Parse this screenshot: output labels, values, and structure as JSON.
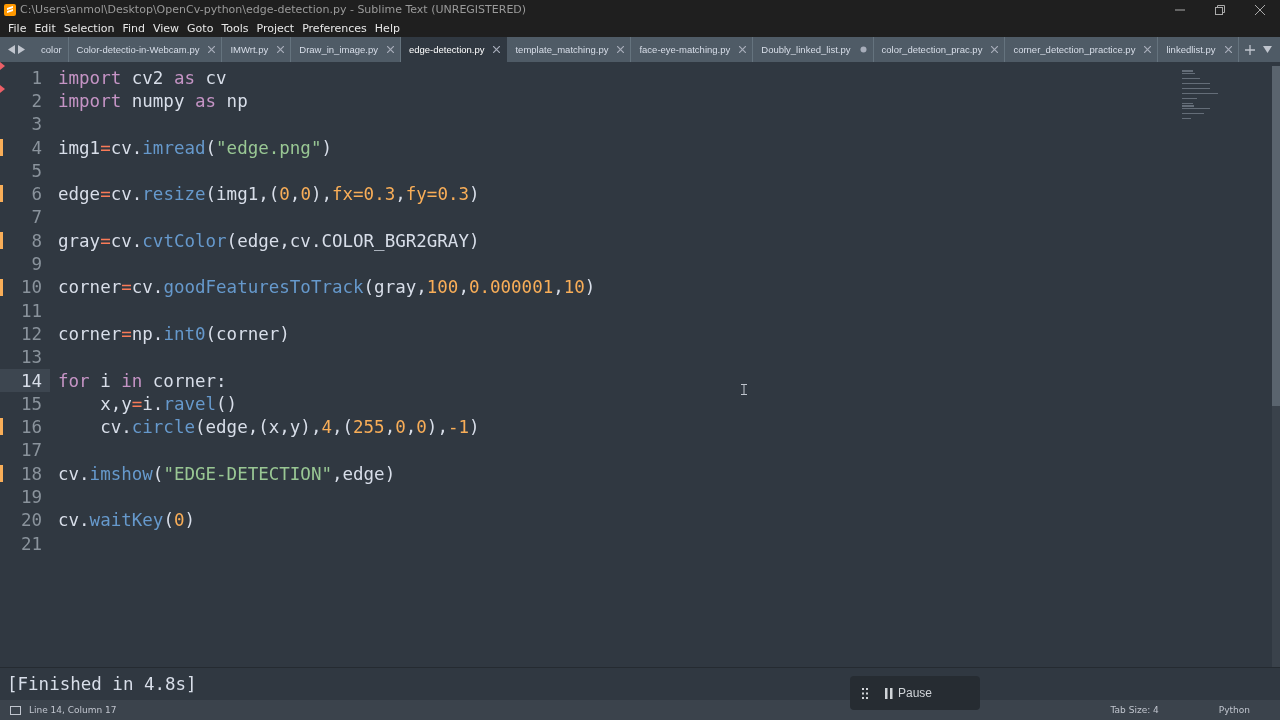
{
  "window": {
    "title": "C:\\Users\\anmol\\Desktop\\OpenCv-python\\edge-detection.py - Sublime Text (UNREGISTERED)"
  },
  "menu": [
    "File",
    "Edit",
    "Selection",
    "Find",
    "View",
    "Goto",
    "Tools",
    "Project",
    "Preferences",
    "Help"
  ],
  "tabs": [
    {
      "label": "color",
      "selected": false
    },
    {
      "label": "Color-detectio-in-Webcam.py",
      "selected": false,
      "unsaved": false
    },
    {
      "label": "IMWrt.py",
      "selected": false,
      "unsaved": false
    },
    {
      "label": "Draw_in_image.py",
      "selected": false,
      "unsaved": false
    },
    {
      "label": "edge-detection.py",
      "selected": true,
      "unsaved": false
    },
    {
      "label": "template_matching.py",
      "selected": false,
      "unsaved": false
    },
    {
      "label": "face-eye-matching.py",
      "selected": false,
      "unsaved": false
    },
    {
      "label": "Doubly_linked_list.py",
      "selected": false,
      "unsaved": true
    },
    {
      "label": "color_detection_prac.py",
      "selected": false,
      "unsaved": false
    },
    {
      "label": "corner_detection_practice.py",
      "selected": false,
      "unsaved": false
    },
    {
      "label": "linkedlist.py",
      "selected": false,
      "unsaved": false
    }
  ],
  "editor": {
    "lines": [
      {
        "number": "1",
        "deleted": true,
        "modified": false,
        "current": false,
        "tokens": [
          {
            "kind": "kw",
            "text": "import"
          },
          {
            "kind": "plain",
            "text": " cv2 "
          },
          {
            "kind": "kw",
            "text": "as"
          },
          {
            "kind": "plain",
            "text": " cv"
          }
        ]
      },
      {
        "number": "2",
        "deleted": true,
        "modified": false,
        "current": false,
        "tokens": [
          {
            "kind": "kw",
            "text": "import"
          },
          {
            "kind": "plain",
            "text": " numpy "
          },
          {
            "kind": "kw",
            "text": "as"
          },
          {
            "kind": "plain",
            "text": " np"
          }
        ]
      },
      {
        "number": "3",
        "deleted": false,
        "modified": false,
        "current": false
      },
      {
        "number": "4",
        "deleted": false,
        "modified": true,
        "current": false,
        "tokens": [
          {
            "kind": "plain",
            "text": "img1"
          },
          {
            "kind": "op",
            "text": "="
          },
          {
            "kind": "plain",
            "text": "cv."
          },
          {
            "kind": "fn",
            "text": "imread"
          },
          {
            "kind": "plain",
            "text": "("
          },
          {
            "kind": "str",
            "text": "\"edge.png\""
          },
          {
            "kind": "plain",
            "text": ")"
          }
        ]
      },
      {
        "number": "5",
        "deleted": false,
        "modified": false,
        "current": false
      },
      {
        "number": "6",
        "deleted": false,
        "modified": true,
        "current": false,
        "tokens": [
          {
            "kind": "plain",
            "text": "edge"
          },
          {
            "kind": "op",
            "text": "="
          },
          {
            "kind": "plain",
            "text": "cv."
          },
          {
            "kind": "fn",
            "text": "resize"
          },
          {
            "kind": "plain",
            "text": "(img1,("
          },
          {
            "kind": "num",
            "text": "0"
          },
          {
            "kind": "plain",
            "text": ","
          },
          {
            "kind": "num",
            "text": "0"
          },
          {
            "kind": "plain",
            "text": "),"
          },
          {
            "kind": "num",
            "text": "fx=0.3"
          },
          {
            "kind": "plain",
            "text": ","
          },
          {
            "kind": "num",
            "text": "fy=0.3"
          },
          {
            "kind": "plain",
            "text": ")"
          }
        ]
      },
      {
        "number": "7",
        "deleted": false,
        "modified": false,
        "current": false
      },
      {
        "number": "8",
        "deleted": false,
        "modified": true,
        "current": false,
        "tokens": [
          {
            "kind": "plain",
            "text": "gray"
          },
          {
            "kind": "op",
            "text": "="
          },
          {
            "kind": "plain",
            "text": "cv."
          },
          {
            "kind": "fn",
            "text": "cvtColor"
          },
          {
            "kind": "plain",
            "text": "(edge,cv.COLOR_BGR2GRAY)"
          }
        ]
      },
      {
        "number": "9",
        "deleted": false,
        "modified": false,
        "current": false
      },
      {
        "number": "10",
        "deleted": false,
        "modified": true,
        "current": false,
        "tokens": [
          {
            "kind": "plain",
            "text": "corner"
          },
          {
            "kind": "op",
            "text": "="
          },
          {
            "kind": "plain",
            "text": "cv."
          },
          {
            "kind": "fn",
            "text": "goodFeaturesToTrack"
          },
          {
            "kind": "plain",
            "text": "(gray,"
          },
          {
            "kind": "num",
            "text": "100"
          },
          {
            "kind": "plain",
            "text": ","
          },
          {
            "kind": "num",
            "text": "0.000001"
          },
          {
            "kind": "plain",
            "text": ","
          },
          {
            "kind": "num",
            "text": "10"
          },
          {
            "kind": "plain",
            "text": ")"
          }
        ]
      },
      {
        "number": "11",
        "deleted": false,
        "modified": false,
        "current": false
      },
      {
        "number": "12",
        "deleted": false,
        "modified": false,
        "current": false,
        "tokens": [
          {
            "kind": "plain",
            "text": "corner"
          },
          {
            "kind": "op",
            "text": "="
          },
          {
            "kind": "plain",
            "text": "np."
          },
          {
            "kind": "fn",
            "text": "int0"
          },
          {
            "kind": "plain",
            "text": "(corner)"
          }
        ]
      },
      {
        "number": "13",
        "deleted": false,
        "modified": false,
        "current": false
      },
      {
        "number": "14",
        "deleted": false,
        "modified": false,
        "current": true,
        "tokens": [
          {
            "kind": "kw",
            "text": "for"
          },
          {
            "kind": "plain",
            "text": " i "
          },
          {
            "kind": "kw",
            "text": "in"
          },
          {
            "kind": "plain",
            "text": " corner:"
          }
        ]
      },
      {
        "number": "15",
        "deleted": false,
        "modified": false,
        "current": false,
        "tokens": [
          {
            "kind": "plain",
            "text": "    x,y"
          },
          {
            "kind": "op",
            "text": "="
          },
          {
            "kind": "plain",
            "text": "i."
          },
          {
            "kind": "fn",
            "text": "ravel"
          },
          {
            "kind": "plain",
            "text": "()"
          }
        ]
      },
      {
        "number": "16",
        "deleted": false,
        "modified": true,
        "current": false,
        "tokens": [
          {
            "kind": "plain",
            "text": "    cv."
          },
          {
            "kind": "fn",
            "text": "circle"
          },
          {
            "kind": "plain",
            "text": "(edge,(x,y),"
          },
          {
            "kind": "num",
            "text": "4"
          },
          {
            "kind": "plain",
            "text": ",("
          },
          {
            "kind": "num",
            "text": "255"
          },
          {
            "kind": "plain",
            "text": ","
          },
          {
            "kind": "num",
            "text": "0"
          },
          {
            "kind": "plain",
            "text": ","
          },
          {
            "kind": "num",
            "text": "0"
          },
          {
            "kind": "plain",
            "text": "),"
          },
          {
            "kind": "num",
            "text": "-1"
          },
          {
            "kind": "plain",
            "text": ")"
          }
        ]
      },
      {
        "number": "17",
        "deleted": false,
        "modified": false,
        "current": false
      },
      {
        "number": "18",
        "deleted": false,
        "modified": true,
        "current": false,
        "tokens": [
          {
            "kind": "plain",
            "text": "cv."
          },
          {
            "kind": "fn",
            "text": "imshow"
          },
          {
            "kind": "plain",
            "text": "("
          },
          {
            "kind": "str",
            "text": "\"EDGE-DETECTION\""
          },
          {
            "kind": "plain",
            "text": ",edge)"
          }
        ]
      },
      {
        "number": "19",
        "deleted": false,
        "modified": false,
        "current": false
      },
      {
        "number": "20",
        "deleted": false,
        "modified": false,
        "current": false,
        "tokens": [
          {
            "kind": "plain",
            "text": "cv."
          },
          {
            "kind": "fn",
            "text": "waitKey"
          },
          {
            "kind": "plain",
            "text": "("
          },
          {
            "kind": "num",
            "text": "0"
          },
          {
            "kind": "plain",
            "text": ")"
          }
        ]
      },
      {
        "number": "21",
        "deleted": false,
        "modified": false,
        "current": false
      }
    ]
  },
  "output": {
    "text": "[Finished in 4.8s]"
  },
  "recorder": {
    "button": "Pause"
  },
  "status_bar": {
    "position": "Line 14, Column 17",
    "tab_size": "Tab Size: 4",
    "syntax": "Python"
  }
}
